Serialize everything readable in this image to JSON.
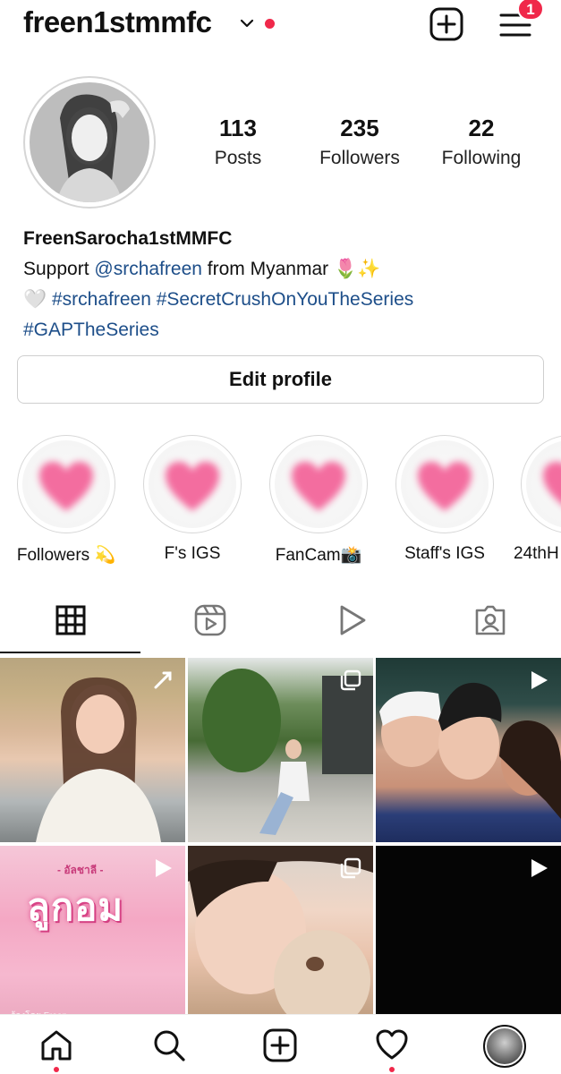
{
  "header": {
    "username": "freen1stmmfc",
    "menu_badge": "1"
  },
  "profile": {
    "stats": [
      {
        "value": "113",
        "label": "Posts"
      },
      {
        "value": "235",
        "label": "Followers"
      },
      {
        "value": "22",
        "label": "Following"
      }
    ],
    "bio": {
      "name": "FreenSarocha1stMMFC",
      "line1_prefix": "Support ",
      "line1_mention": "@srchafreen",
      "line1_suffix": " from Myanmar 🌷✨",
      "line2_prefix": "🤍 ",
      "line2_tags": "#srchafreen #SecretCrushOnYouTheSeries",
      "line3_tags": "#GAPTheSeries"
    },
    "edit_button_label": "Edit profile"
  },
  "highlights": [
    {
      "label": "Followers 💫"
    },
    {
      "label": "F's IGS"
    },
    {
      "label": "FanCam📸"
    },
    {
      "label": "Staff's IGS"
    },
    {
      "label": "24thH"
    }
  ],
  "tabs": [
    {
      "icon": "grid-icon",
      "active": true
    },
    {
      "icon": "reels-icon",
      "active": false
    },
    {
      "icon": "play-icon",
      "active": false
    },
    {
      "icon": "tagged-icon",
      "active": false
    }
  ],
  "grid": {
    "cell4_top": "- อัลชาลี -",
    "cell4_title": "ลูกอม",
    "cell4_sub": "ร้องโดย Freen"
  },
  "bottom_nav": [
    "home-icon",
    "search-icon",
    "create-icon",
    "activity-icon",
    "profile-avatar"
  ],
  "colors": {
    "accent_red": "#f0284a",
    "link_blue": "#1d4e89",
    "heart_pink": "#f36d9f"
  }
}
